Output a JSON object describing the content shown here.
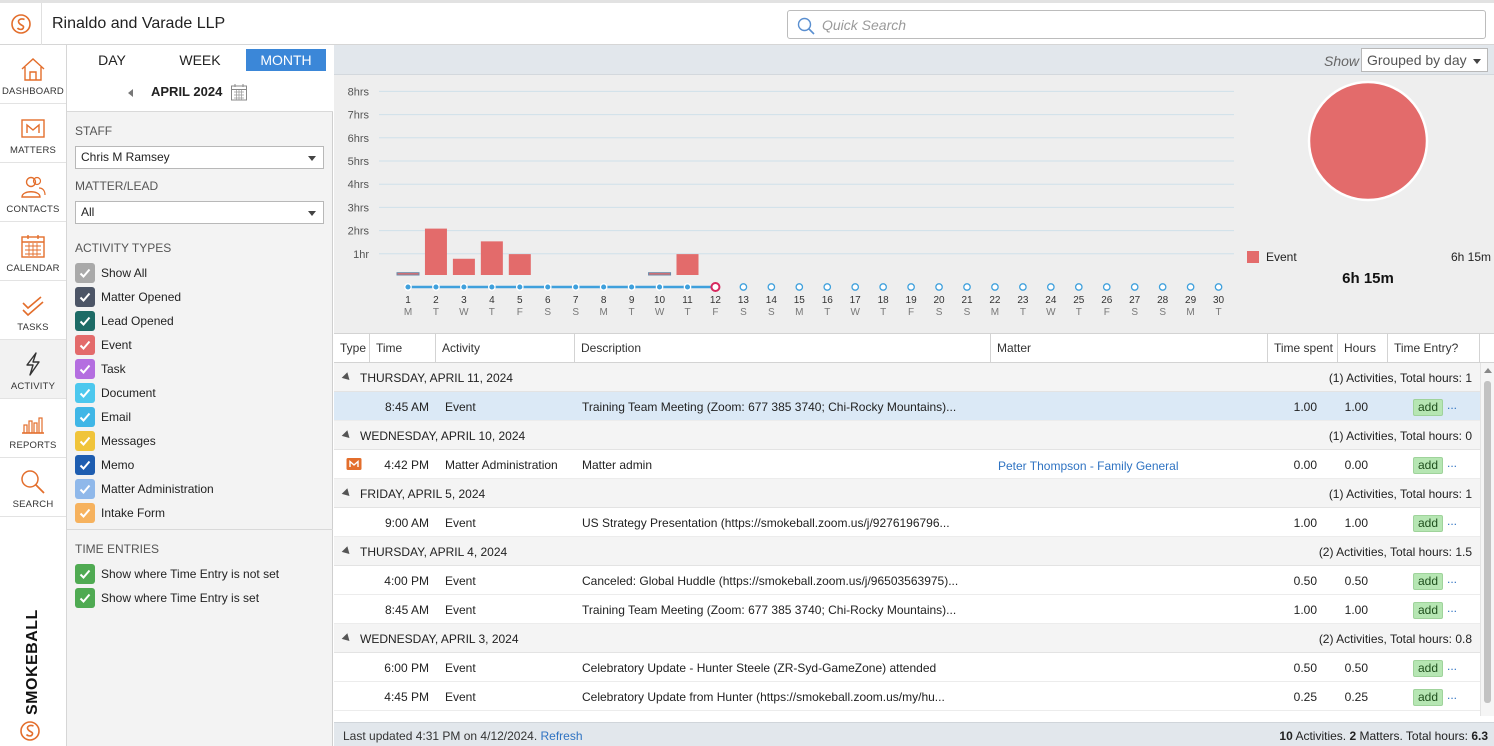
{
  "app": {
    "firm_name": "Rinaldo and Varade LLP",
    "search_placeholder": "Quick Search",
    "brand_text": "SMOKEBALL",
    "accent": "#e36e2c"
  },
  "nav": [
    {
      "label": "DASHBOARD",
      "icon": "home-icon"
    },
    {
      "label": "MATTERS",
      "icon": "matters-icon"
    },
    {
      "label": "CONTACTS",
      "icon": "contacts-icon"
    },
    {
      "label": "CALENDAR",
      "icon": "calendar-icon"
    },
    {
      "label": "TASKS",
      "icon": "tasks-icon"
    },
    {
      "label": "ACTIVITY",
      "icon": "activity-icon",
      "active": true
    },
    {
      "label": "REPORTS",
      "icon": "reports-icon"
    },
    {
      "label": "SEARCH",
      "icon": "search-icon"
    }
  ],
  "filter": {
    "tabs": {
      "day": "DAY",
      "week": "WEEK",
      "month": "MONTH",
      "active": "month"
    },
    "period_label": "APRIL 2024",
    "staff_label": "STAFF",
    "staff_value": "Chris M Ramsey",
    "matter_label": "MATTER/LEAD",
    "matter_value": "All",
    "activity_types_label": "ACTIVITY TYPES",
    "activity_types": [
      {
        "label": "Show All",
        "color": "#a9a9a9"
      },
      {
        "label": "Matter Opened",
        "color": "#4c5566"
      },
      {
        "label": "Lead Opened",
        "color": "#1d6b66"
      },
      {
        "label": "Event",
        "color": "#e36b6b"
      },
      {
        "label": "Task",
        "color": "#b46ee0"
      },
      {
        "label": "Document",
        "color": "#4cc8ee"
      },
      {
        "label": "Email",
        "color": "#3fb6e6"
      },
      {
        "label": "Messages",
        "color": "#f0c43a"
      },
      {
        "label": "Memo",
        "color": "#1e5db0"
      },
      {
        "label": "Matter Administration",
        "color": "#8fb8ea"
      },
      {
        "label": "Intake Form",
        "color": "#f6b25e"
      }
    ],
    "time_entries_label": "TIME ENTRIES",
    "time_entries": [
      {
        "label": "Show where Time Entry is not set",
        "color": "#4faa52"
      },
      {
        "label": "Show where Time Entry is set",
        "color": "#4faa52"
      }
    ]
  },
  "main": {
    "show_label": "Show",
    "show_value": "Grouped by day",
    "table": {
      "columns": [
        "Type",
        "Time",
        "Activity",
        "Description",
        "Matter",
        "Time spent",
        "Hours",
        "Time Entry?"
      ],
      "add_label": "add",
      "more_label": "...",
      "groups": [
        {
          "title": "THURSDAY, APRIL 11, 2024",
          "summary": "(1) Activities, Total hours: 1",
          "rows": [
            {
              "time": "8:45 AM",
              "activity": "Event",
              "description": "Training Team Meeting (Zoom: 677 385 3740; Chi-Rocky Mountains)...",
              "matter": "",
              "time_spent": "1.00",
              "hours": "1.00",
              "selected": true
            }
          ]
        },
        {
          "title": "WEDNESDAY, APRIL 10, 2024",
          "summary": "(1) Activities, Total hours: 0",
          "rows": [
            {
              "type_icon": "matter-admin-icon",
              "time": "4:42 PM",
              "activity": "Matter Administration",
              "description": "Matter admin",
              "matter": "Peter Thompson - Family General",
              "time_spent": "0.00",
              "hours": "0.00"
            }
          ]
        },
        {
          "title": "FRIDAY, APRIL 5, 2024",
          "summary": "(1) Activities, Total hours: 1",
          "rows": [
            {
              "time": "9:00 AM",
              "activity": "Event",
              "description": "US Strategy Presentation  (https://smokeball.zoom.us/j/9276196796...",
              "matter": "",
              "time_spent": "1.00",
              "hours": "1.00"
            }
          ]
        },
        {
          "title": "THURSDAY, APRIL 4, 2024",
          "summary": "(2) Activities, Total hours: 1.5",
          "rows": [
            {
              "time": "4:00 PM",
              "activity": "Event",
              "description": "Canceled: Global Huddle (https://smokeball.zoom.us/j/96503563975)...",
              "matter": "",
              "time_spent": "0.50",
              "hours": "0.50"
            },
            {
              "time": "8:45 AM",
              "activity": "Event",
              "description": "Training Team Meeting (Zoom: 677 385 3740; Chi-Rocky Mountains)...",
              "matter": "",
              "time_spent": "1.00",
              "hours": "1.00"
            }
          ]
        },
        {
          "title": "WEDNESDAY, APRIL 3, 2024",
          "summary": "(2) Activities, Total hours: 0.8",
          "rows": [
            {
              "time": "6:00 PM",
              "activity": "Event",
              "description": "Celebratory Update - Hunter Steele  (ZR-Syd-GameZone) attended",
              "matter": "",
              "time_spent": "0.50",
              "hours": "0.50"
            },
            {
              "time": "4:45 PM",
              "activity": "Event",
              "description": "Celebratory Update from Hunter (https://smokeball.zoom.us/my/hu...",
              "matter": "",
              "time_spent": "0.25",
              "hours": "0.25"
            }
          ]
        }
      ]
    },
    "footer": {
      "last_updated": "Last updated 4:31 PM on 4/12/2024.",
      "refresh": "Refresh",
      "activities_count": "10",
      "activities_word": " Activities. ",
      "matters_count": "2",
      "matters_word": " Matters. Total hours: ",
      "total_hours": "6.3"
    }
  },
  "chart_data": {
    "type": "bar",
    "y_ticks": [
      "1hr",
      "2hrs",
      "3hrs",
      "4hrs",
      "5hrs",
      "6hrs",
      "7hrs",
      "8hrs"
    ],
    "ylim": [
      0,
      8
    ],
    "x": [
      1,
      2,
      3,
      4,
      5,
      6,
      7,
      8,
      9,
      10,
      11,
      12,
      13,
      14,
      15,
      16,
      17,
      18,
      19,
      20,
      21,
      22,
      23,
      24,
      25,
      26,
      27,
      28,
      29,
      30
    ],
    "weekdays": [
      "M",
      "T",
      "W",
      "T",
      "F",
      "S",
      "S",
      "M",
      "T",
      "W",
      "T",
      "F",
      "S",
      "S",
      "M",
      "T",
      "W",
      "T",
      "F",
      "S",
      "S",
      "M",
      "T",
      "W",
      "T",
      "F",
      "S",
      "S",
      "M",
      "T"
    ],
    "series": [
      {
        "name": "Event",
        "color": "#e36b6b",
        "values": [
          0.1,
          2.0,
          0.7,
          1.45,
          0.9,
          0,
          0,
          0,
          0,
          0.1,
          0.9,
          0,
          0,
          0,
          0,
          0,
          0,
          0,
          0,
          0,
          0,
          0,
          0,
          0,
          0,
          0,
          0,
          0,
          0,
          0
        ]
      }
    ],
    "today": 12,
    "pie": {
      "slices": [
        {
          "name": "Event",
          "value": 6.25,
          "label": "6h 15m",
          "color": "#e36b6b"
        }
      ],
      "total_label": "6h 15m"
    }
  }
}
